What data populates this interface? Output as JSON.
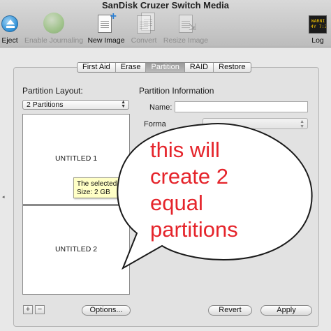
{
  "window": {
    "title": "SanDisk Cruzer Switch Media"
  },
  "toolbar": {
    "eject": "Eject",
    "enable_journaling": "Enable Journaling",
    "new_image": "New Image",
    "convert": "Convert",
    "resize_image": "Resize Image",
    "log": "Log",
    "log_icon_text": "WARNI\n4Y 7:36"
  },
  "tabs": [
    {
      "label": "First Aid",
      "selected": false
    },
    {
      "label": "Erase",
      "selected": false
    },
    {
      "label": "Partition",
      "selected": true
    },
    {
      "label": "RAID",
      "selected": false
    },
    {
      "label": "Restore",
      "selected": false
    }
  ],
  "partition_layout": {
    "label": "Partition Layout:",
    "selected": "2 Partitions",
    "partitions": [
      "UNTITLED 1",
      "UNTITLED 2"
    ]
  },
  "partition_info": {
    "heading": "Partition Information",
    "name_label": "Name:",
    "name_value": "",
    "format_label": "Forma"
  },
  "tooltip": {
    "line1": "The selected p",
    "line2": "Size: 2 GB"
  },
  "buttons": {
    "add": "+",
    "remove": "−",
    "options": "Options...",
    "revert": "Revert",
    "apply": "Apply"
  },
  "annotation": {
    "text": "this will\ncreate 2\nequal\npartitions",
    "color": "#e5242b"
  },
  "colors": {
    "toolbar_bg": "#c9c9c9",
    "selected_tab": "#a8a8a8",
    "tooltip_bg": "#ffffc6"
  }
}
